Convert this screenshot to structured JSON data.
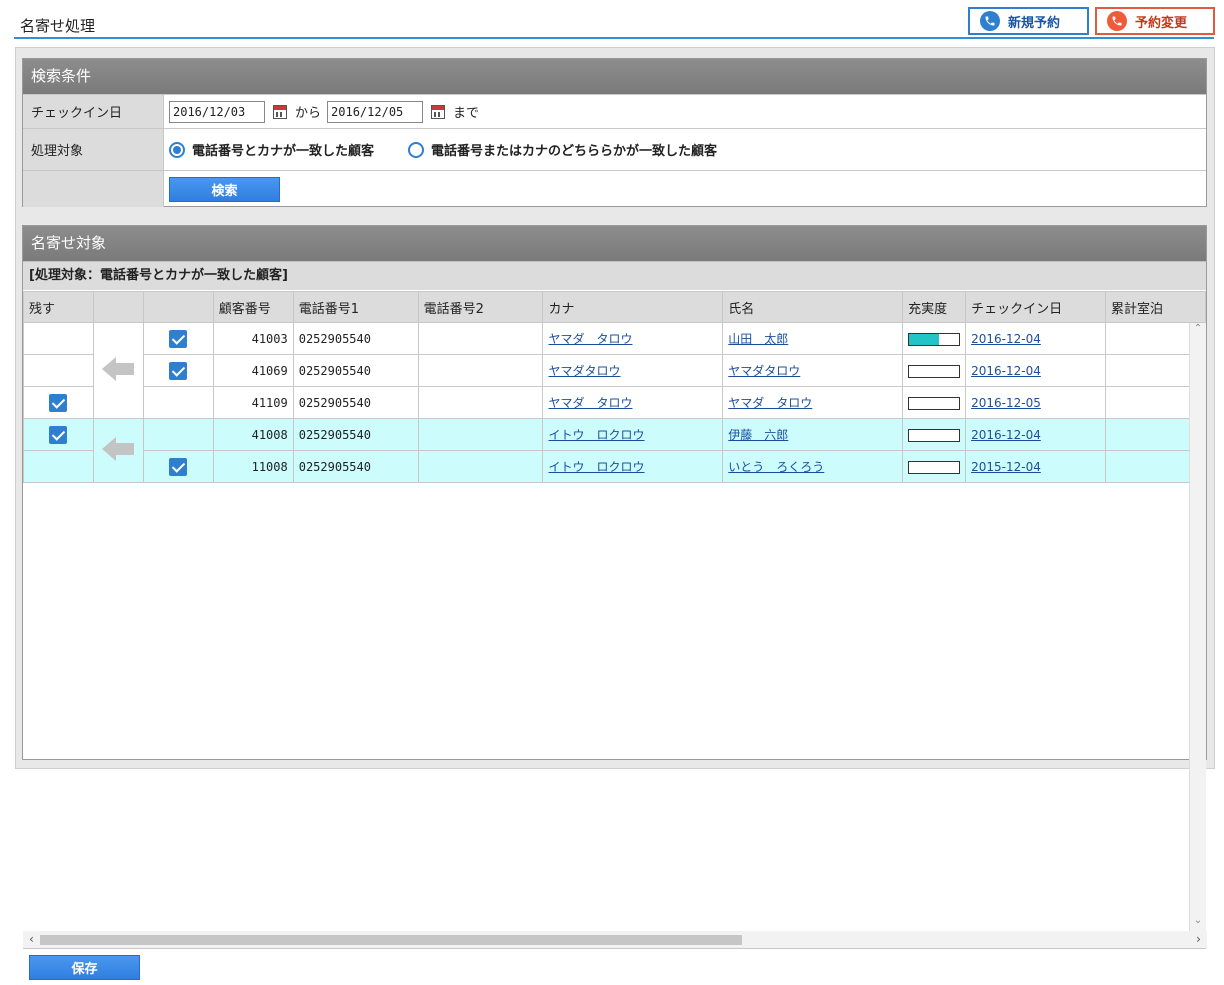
{
  "header": {
    "title": "名寄せ処理",
    "new_reservation": "新規予約",
    "change_reservation": "予約変更"
  },
  "search": {
    "title": "検索条件",
    "checkin_label": "チェックイン日",
    "date_from": "2016/12/03",
    "from_text": "から",
    "date_to": "2016/12/05",
    "to_text": "まで",
    "target_label": "処理対象",
    "option1": "電話番号とカナが一致した顧客",
    "option2": "電話番号またはカナのどちららかが一致した顧客",
    "search_button": "検索"
  },
  "targets": {
    "title": "名寄せ対象",
    "subheading": "[処理対象：電話番号とカナが一致した顧客]",
    "columns": [
      "残す",
      "",
      "",
      "顧客番号",
      "電話番号1",
      "電話番号2",
      "カナ",
      "氏名",
      "充実度",
      "チェックイン日",
      "累計室泊"
    ],
    "rows": [
      {
        "keep": false,
        "selected": true,
        "id": "41003",
        "tel1": "0252905540",
        "tel2": "",
        "kana": "ヤマダ　タロウ",
        "name": "山田　太郎",
        "fill": 0.6,
        "checkin": "2016-12-04",
        "highlight": false
      },
      {
        "keep": false,
        "selected": true,
        "id": "41069",
        "tel1": "0252905540",
        "tel2": "",
        "kana": "ヤマダタロウ",
        "name": "ヤマダタロウ",
        "fill": 0,
        "checkin": "2016-12-04",
        "highlight": false
      },
      {
        "keep": true,
        "selected": false,
        "id": "41109",
        "tel1": "0252905540",
        "tel2": "",
        "kana": "ヤマダ　タロウ",
        "name": "ヤマダ　タロウ",
        "fill": 0,
        "checkin": "2016-12-05",
        "highlight": false
      },
      {
        "keep": true,
        "selected": false,
        "id": "41008",
        "tel1": "0252905540",
        "tel2": "",
        "kana": "イトウ　ロクロウ",
        "name": "伊藤　六郎",
        "fill": 0,
        "checkin": "2016-12-04",
        "highlight": true
      },
      {
        "keep": false,
        "selected": true,
        "id": "11008",
        "tel1": "0252905540",
        "tel2": "",
        "kana": "イトウ　ロクロウ",
        "name": "いとう　ろくろう",
        "fill": 0,
        "checkin": "2015-12-04",
        "highlight": true
      }
    ],
    "save_button": "保存"
  },
  "colors": {
    "accent": "#2f7fd0",
    "danger": "#e05a3d",
    "highlight_row": "#ccfcfc",
    "fill_bar": "#22c4c8"
  }
}
